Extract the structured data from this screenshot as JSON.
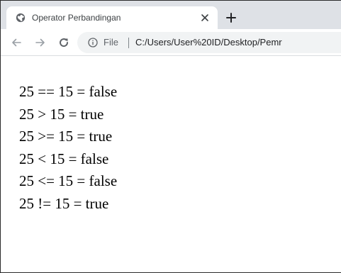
{
  "browser": {
    "tab": {
      "title": "Operator Perbandingan",
      "favicon": "globe-icon",
      "close_icon": "close-icon"
    },
    "new_tab_icon": "plus-icon",
    "toolbar": {
      "back_icon": "arrow-left-icon",
      "forward_icon": "arrow-right-icon",
      "reload_icon": "reload-icon",
      "info_icon": "info-circle-icon",
      "chip_label": "File",
      "url": "C:/Users/User%20ID/Desktop/Pemr"
    }
  },
  "page": {
    "lines": [
      "25 == 15 = false",
      "25 > 15 = true",
      "25 >= 15 = true",
      "25 < 15 = false",
      "25 <= 15 = false",
      "25 != 15 = true"
    ]
  },
  "colors": {
    "tabstrip": "#dee1e6",
    "omnibox": "#f1f3f4",
    "text": "#000000",
    "icon": "#5f6368"
  }
}
